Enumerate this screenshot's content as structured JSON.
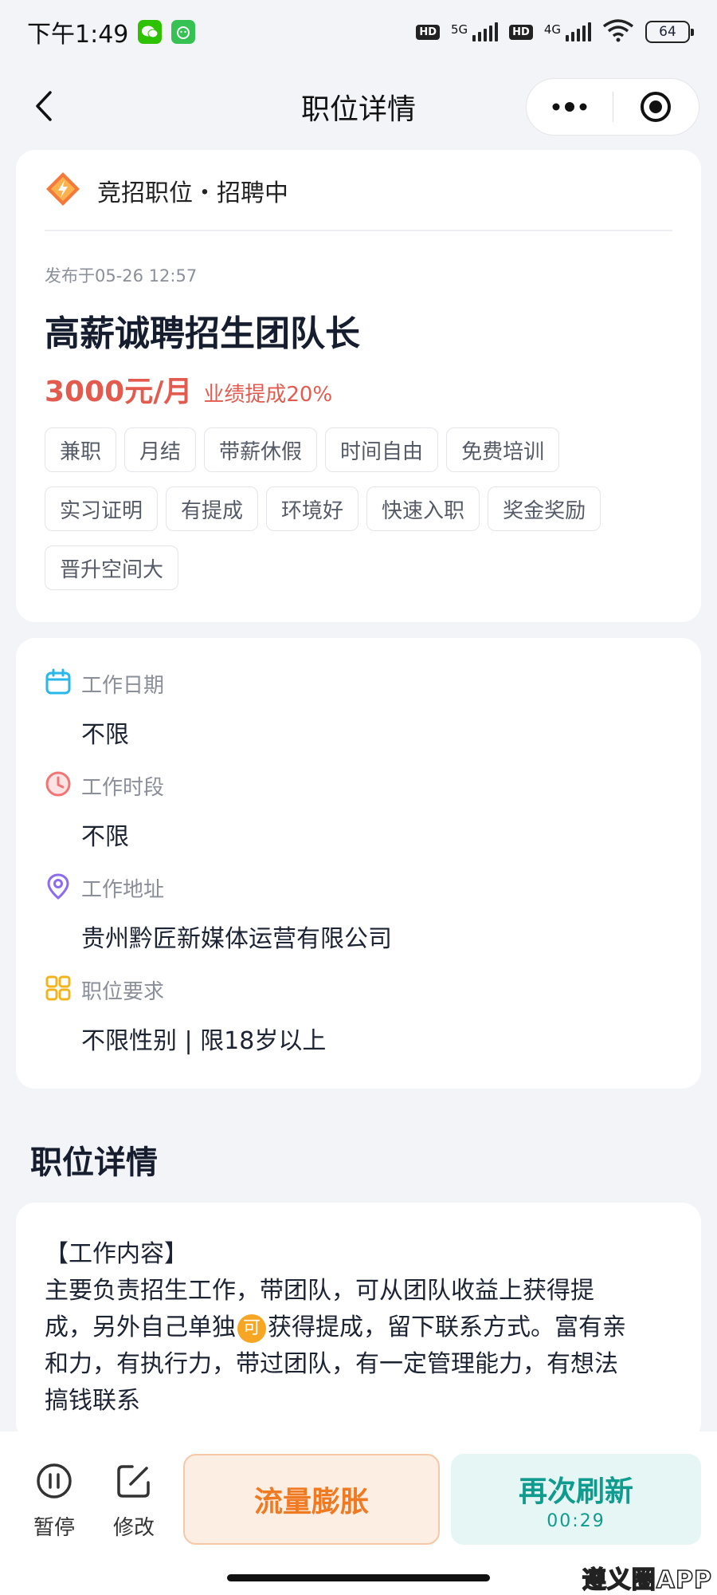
{
  "status_bar": {
    "time": "下午1:49",
    "net1_label": "5G",
    "net2_label": "4G",
    "hd_label": "HD",
    "battery": "64"
  },
  "nav": {
    "title": "职位详情"
  },
  "job": {
    "type_label": "竞招职位・招聘中",
    "published": "发布于05-26 12:57",
    "title": "高薪诚聘招生团队长",
    "salary": "3000元/月",
    "commission": "业绩提成20%",
    "tags": [
      "兼职",
      "月结",
      "带薪休假",
      "时间自由",
      "免费培训",
      "实习证明",
      "有提成",
      "环境好",
      "快速入职",
      "奖金奖励",
      "晋升空间大"
    ]
  },
  "info": {
    "date_label": "工作日期",
    "date_value": "不限",
    "period_label": "工作时段",
    "period_value": "不限",
    "address_label": "工作地址",
    "address_value": "贵州黔匠新媒体运营有限公司",
    "req_label": "职位要求",
    "req_value": "不限性别 | 限18岁以上"
  },
  "details": {
    "section_title": "职位详情",
    "heading": "【工作内容】",
    "line1": "主要负责招生工作，带团队，可从团队收益上获得提",
    "line2_a": "成，另外自己单独",
    "badge": "可",
    "line2_b": "获得提成，留下联系方式。富有亲",
    "line3": "和力，有执行力，带过团队，有一定管理能力，有想法",
    "line4": "搞钱联系"
  },
  "bottom": {
    "pause_label": "暂停",
    "edit_label": "修改",
    "flow_label": "流量膨胀",
    "refresh_label": "再次刷新",
    "refresh_timer": "00:29"
  },
  "watermark": "遵义圈APP",
  "colors": {
    "salary": "#e35b4f",
    "flow_button": "#ef7a22",
    "refresh_button": "#0f9b8e",
    "calendar_icon": "#29b6e8",
    "clock_icon": "#f07575",
    "location_icon": "#8b6cf0",
    "grid_icon": "#f2b41c"
  }
}
